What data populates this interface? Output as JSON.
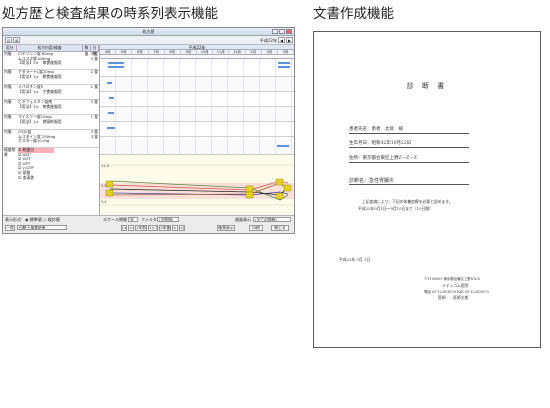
{
  "captions": {
    "left": "処方歴と検査結果の時系列表示機能",
    "right": "文書作成機能"
  },
  "app": {
    "window_title": "処方歴",
    "toolbar_left_buttons": [
      "⊟",
      "⊞"
    ],
    "toolbar_right_label": "平成22年",
    "toolbar_right_buttons": [
      "◀",
      "▶"
    ],
    "left_header": {
      "category": "区分",
      "name": "処方内容/検査",
      "qty": "数量",
      "days": "日数"
    },
    "year_label": "平成22年",
    "months": [
      "4月",
      "5月",
      "6月",
      "7月",
      "8月",
      "9月",
      "10月",
      "11月",
      "12月",
      "1月",
      "2月",
      "3月"
    ],
    "prescriptions": [
      {
        "category": "内服",
        "lines": [
          "ロキソニン錠 60mg",
          "ムコスタ錠100mg",
          "【用法】3×　毎食後服用"
        ],
        "qty": "3 錠",
        "days": "3 錠"
      },
      {
        "category": "内服",
        "lines": [
          "アダラートL錠20mg",
          "【用法】1×　朝食後服用"
        ],
        "qty": "2 錠",
        "days": ""
      },
      {
        "category": "内服",
        "lines": [
          "メバロチン錠5",
          "【用法】1×　夕食後服用"
        ],
        "qty": "1 錠",
        "days": ""
      },
      {
        "category": "内服",
        "lines": [
          "ビオフェルミン錠剤",
          "【用法】3×　毎食後服用"
        ],
        "qty": "3 錠",
        "days": ""
      },
      {
        "category": "内服",
        "lines": [
          "マイスリー錠10mg",
          "【用法】1×　就寝前服用"
        ],
        "qty": "1 錠",
        "days": ""
      },
      {
        "category": "内服",
        "lines": [
          "ﾒﾘｽﾛﾝ錠",
          "ムコダイン錠 250mg",
          "ガスター錠10 mg"
        ],
        "qty": "3 錠",
        "days": "3 錠"
      }
    ],
    "tests": {
      "category": "検査結果",
      "items": [
        "☑ 総蛋白",
        "☑ AST",
        "☑ GOT",
        "☑ GPT",
        "☑ γ-GTP",
        "☑ 尿酸",
        "☑ 血清鉄"
      ]
    },
    "chart_axis": [
      "11.0",
      "7.5",
      "5.4",
      "1.7",
      "4.0"
    ],
    "statusbar": {
      "display_label": "表示形式：",
      "display_option_1": "◉ 標準値",
      "display_option_2": "○ 検討値",
      "scale_label": "スケール",
      "scale_value": "期間",
      "scale_sel": "年",
      "filter_label": "フィルタ",
      "filter_value": "(全期間)",
      "display_mode_label": "描画表示",
      "display_mode_value": "(全ての期間)",
      "search_select": "回数＋検査結果",
      "nav_buttons": [
        "|<",
        "<",
        "1年前",
        "1ヶ月",
        "1年後",
        ">",
        ">|"
      ],
      "print_button": "帳票表示",
      "close_button": "閉じる",
      "print_preview_button": "印刷",
      "list_button": "一覧"
    }
  },
  "document": {
    "title": "診 断 書",
    "patient_label": "患者氏名：患者　太郎　様",
    "birth_label": "生年月日：昭和42年10月22日",
    "address_label": "住所：東京都台東区上野Z－Z－Z",
    "diagnosis_label": "診断名：急性胃腸炎",
    "body_line_1": "上記疾病により、下記の休養加療を必要と認めます。",
    "body_line_2": "平成22年9月1日～9月10日まで（10日間）",
    "date": "平成22年 9月 1日",
    "clinic_address": "〒1100005 東京都台東区上野X-X-X",
    "clinic_name": "メディコム医院",
    "clinic_phone": "電話 03-1234-5678 FAX 03-1234-5679",
    "doctor": "医師　　医師太郎"
  },
  "colors": {
    "grid_bar": "#5d93d8",
    "test_selected": "#f7b0b6",
    "chart_bg": "#fdfbea",
    "marker": "#e6d020"
  }
}
